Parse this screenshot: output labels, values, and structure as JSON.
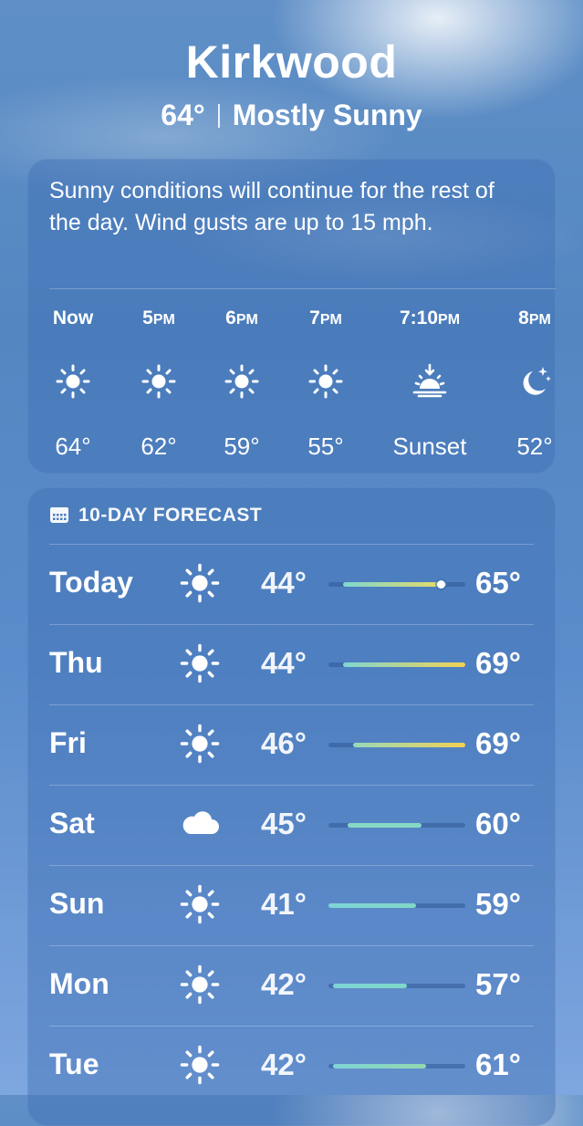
{
  "location": {
    "city": "Kirkwood",
    "current_temp": "64°",
    "condition": "Mostly Sunny"
  },
  "hourly": {
    "summary": "Sunny conditions will continue for the rest of the day. Wind gusts are up to 15 mph.",
    "items": [
      {
        "time": "Now",
        "ampm": "",
        "icon": "sun-icon",
        "value": "64°"
      },
      {
        "time": "5",
        "ampm": "PM",
        "icon": "sun-icon",
        "value": "62°"
      },
      {
        "time": "6",
        "ampm": "PM",
        "icon": "sun-icon",
        "value": "59°"
      },
      {
        "time": "7",
        "ampm": "PM",
        "icon": "sun-icon",
        "value": "55°"
      },
      {
        "time": "7:10",
        "ampm": "PM",
        "icon": "sunset-icon",
        "value": "Sunset"
      },
      {
        "time": "8",
        "ampm": "PM",
        "icon": "moon-stars-icon",
        "value": "52°"
      }
    ]
  },
  "daily": {
    "header": "10-DAY FORECAST",
    "header_icon": "calendar-icon",
    "range_scale": {
      "min": 41,
      "max": 69
    },
    "current_temp_marker": 64,
    "days": [
      {
        "day": "Today",
        "icon": "sun-icon",
        "low": "44°",
        "high": "65°",
        "low_value": 44,
        "high_value": 65,
        "colors": [
          "#7fd7cf",
          "#e8dc60"
        ]
      },
      {
        "day": "Thu",
        "icon": "sun-icon",
        "low": "44°",
        "high": "69°",
        "low_value": 44,
        "high_value": 69,
        "colors": [
          "#7fd7cf",
          "#f2d254"
        ]
      },
      {
        "day": "Fri",
        "icon": "sun-icon",
        "low": "46°",
        "high": "69°",
        "low_value": 46,
        "high_value": 69,
        "colors": [
          "#98d8b8",
          "#f2d254"
        ]
      },
      {
        "day": "Sat",
        "icon": "cloud-icon",
        "low": "45°",
        "high": "60°",
        "low_value": 45,
        "high_value": 60,
        "colors": [
          "#86d8c6",
          "#86d8c6"
        ]
      },
      {
        "day": "Sun",
        "icon": "sun-icon",
        "low": "41°",
        "high": "59°",
        "low_value": 41,
        "high_value": 59,
        "colors": [
          "#7ed4d6",
          "#80d8c8"
        ]
      },
      {
        "day": "Mon",
        "icon": "sun-icon",
        "low": "42°",
        "high": "57°",
        "low_value": 42,
        "high_value": 57,
        "colors": [
          "#7ed4d6",
          "#7ed8c8"
        ]
      },
      {
        "day": "Tue",
        "icon": "sun-icon",
        "low": "42°",
        "high": "61°",
        "low_value": 42,
        "high_value": 61,
        "colors": [
          "#7ed4d6",
          "#92d8b0"
        ]
      }
    ]
  }
}
